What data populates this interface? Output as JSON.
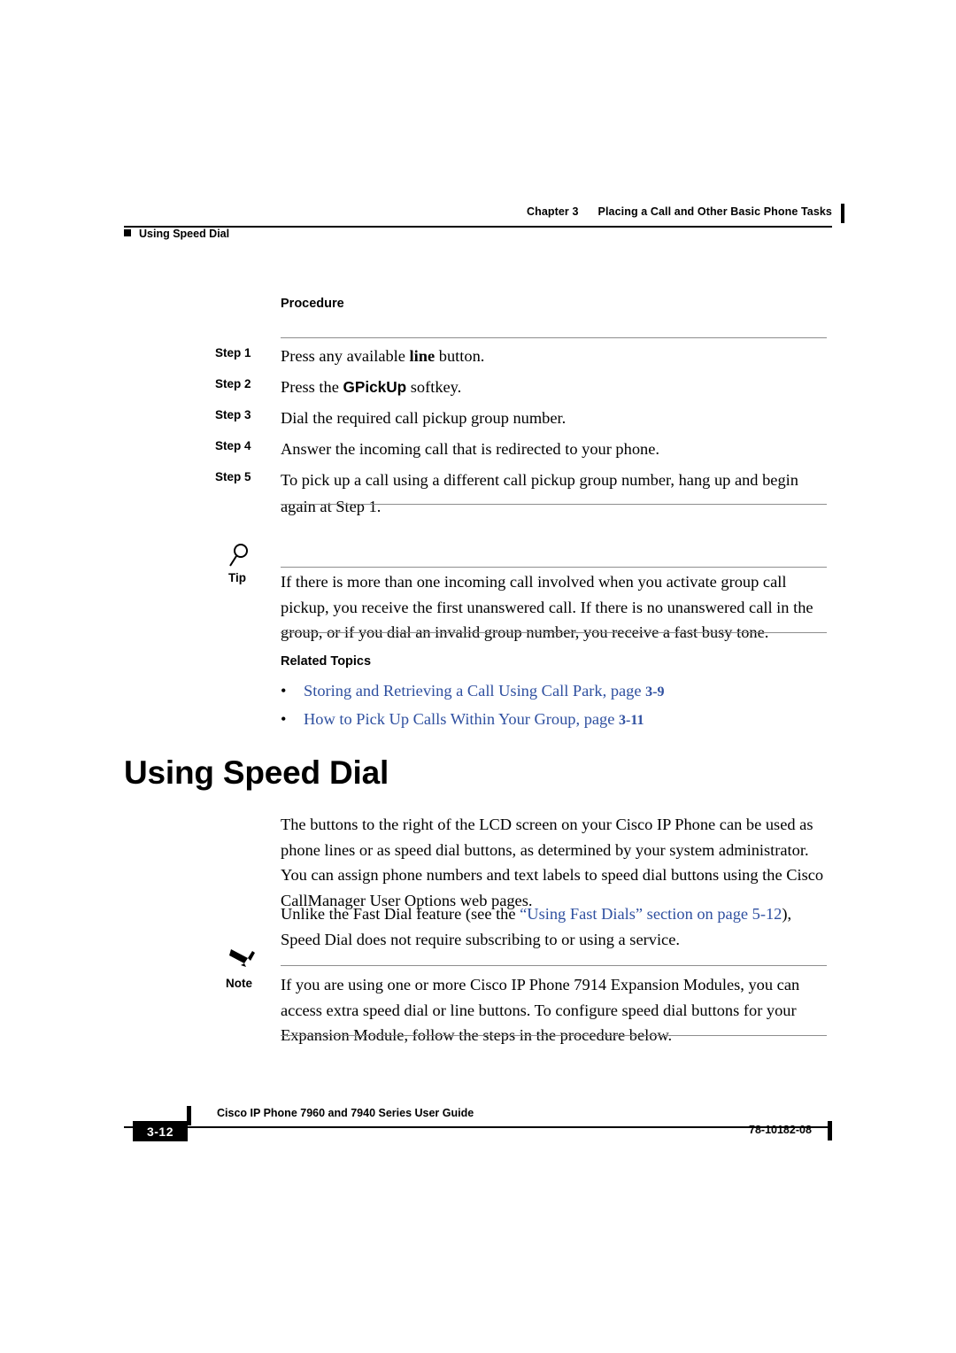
{
  "header": {
    "chapter": "Chapter 3",
    "chapter_title": "Placing a Call and Other Basic Phone Tasks",
    "running_head": "Using Speed Dial"
  },
  "procedure": {
    "title": "Procedure",
    "steps": [
      {
        "label": "Step 1",
        "text_before": "Press any available ",
        "emphasis": "line",
        "text_after": " button.",
        "style": "serif-bold"
      },
      {
        "label": "Step 2",
        "text_before": "Press the ",
        "emphasis": "GPickUp",
        "text_after": " softkey.",
        "style": "sans-bold"
      },
      {
        "label": "Step 3",
        "text_before": "Dial the required call pickup group number.",
        "emphasis": "",
        "text_after": "",
        "style": "none"
      },
      {
        "label": "Step 4",
        "text_before": "Answer the incoming call that is redirected to your phone.",
        "emphasis": "",
        "text_after": "",
        "style": "none"
      },
      {
        "label": "Step 5",
        "text_before": "To pick up a call using a different call pickup group number, hang up and begin again at Step 1.",
        "emphasis": "",
        "text_after": "",
        "style": "none"
      }
    ]
  },
  "tip": {
    "label": "Tip",
    "icon": "magnifier-icon",
    "text": "If there is more than one incoming call involved when you activate group call pickup, you receive the first unanswered call. If there is no unanswered call in the group, or if you dial an invalid group number, you receive a fast busy tone."
  },
  "related": {
    "title": "Related Topics",
    "items": [
      {
        "text": "Storing and Retrieving a Call Using Call Park, page ",
        "page": "3-9"
      },
      {
        "text": "How to Pick Up Calls Within Your Group, page ",
        "page": "3-11"
      }
    ]
  },
  "section": {
    "heading": "Using Speed Dial",
    "paragraph1": "The buttons to the right of the LCD screen on your Cisco IP Phone can be used as phone lines or as speed dial buttons, as determined by your system administrator. You can assign phone numbers and text labels to speed dial buttons using the Cisco CallManager User Options web pages.",
    "paragraph2_before": "Unlike the Fast Dial feature (see the ",
    "paragraph2_link": "“Using Fast Dials” section on page 5-12",
    "paragraph2_after": "), Speed Dial does not require subscribing to or using a service."
  },
  "note": {
    "label": "Note",
    "icon": "pencil-icon",
    "text": "If you are using one or more Cisco IP Phone 7914 Expansion Modules, you can access extra speed dial or line buttons. To configure speed dial buttons for your Expansion Module, follow the steps in the procedure below."
  },
  "footer": {
    "title": "Cisco IP Phone 7960 and 7940 Series User Guide",
    "page_number": "3-12",
    "doc_number": "78-10182-08"
  },
  "colors": {
    "link": "#2f50a0",
    "rule": "#8e8e8e"
  }
}
